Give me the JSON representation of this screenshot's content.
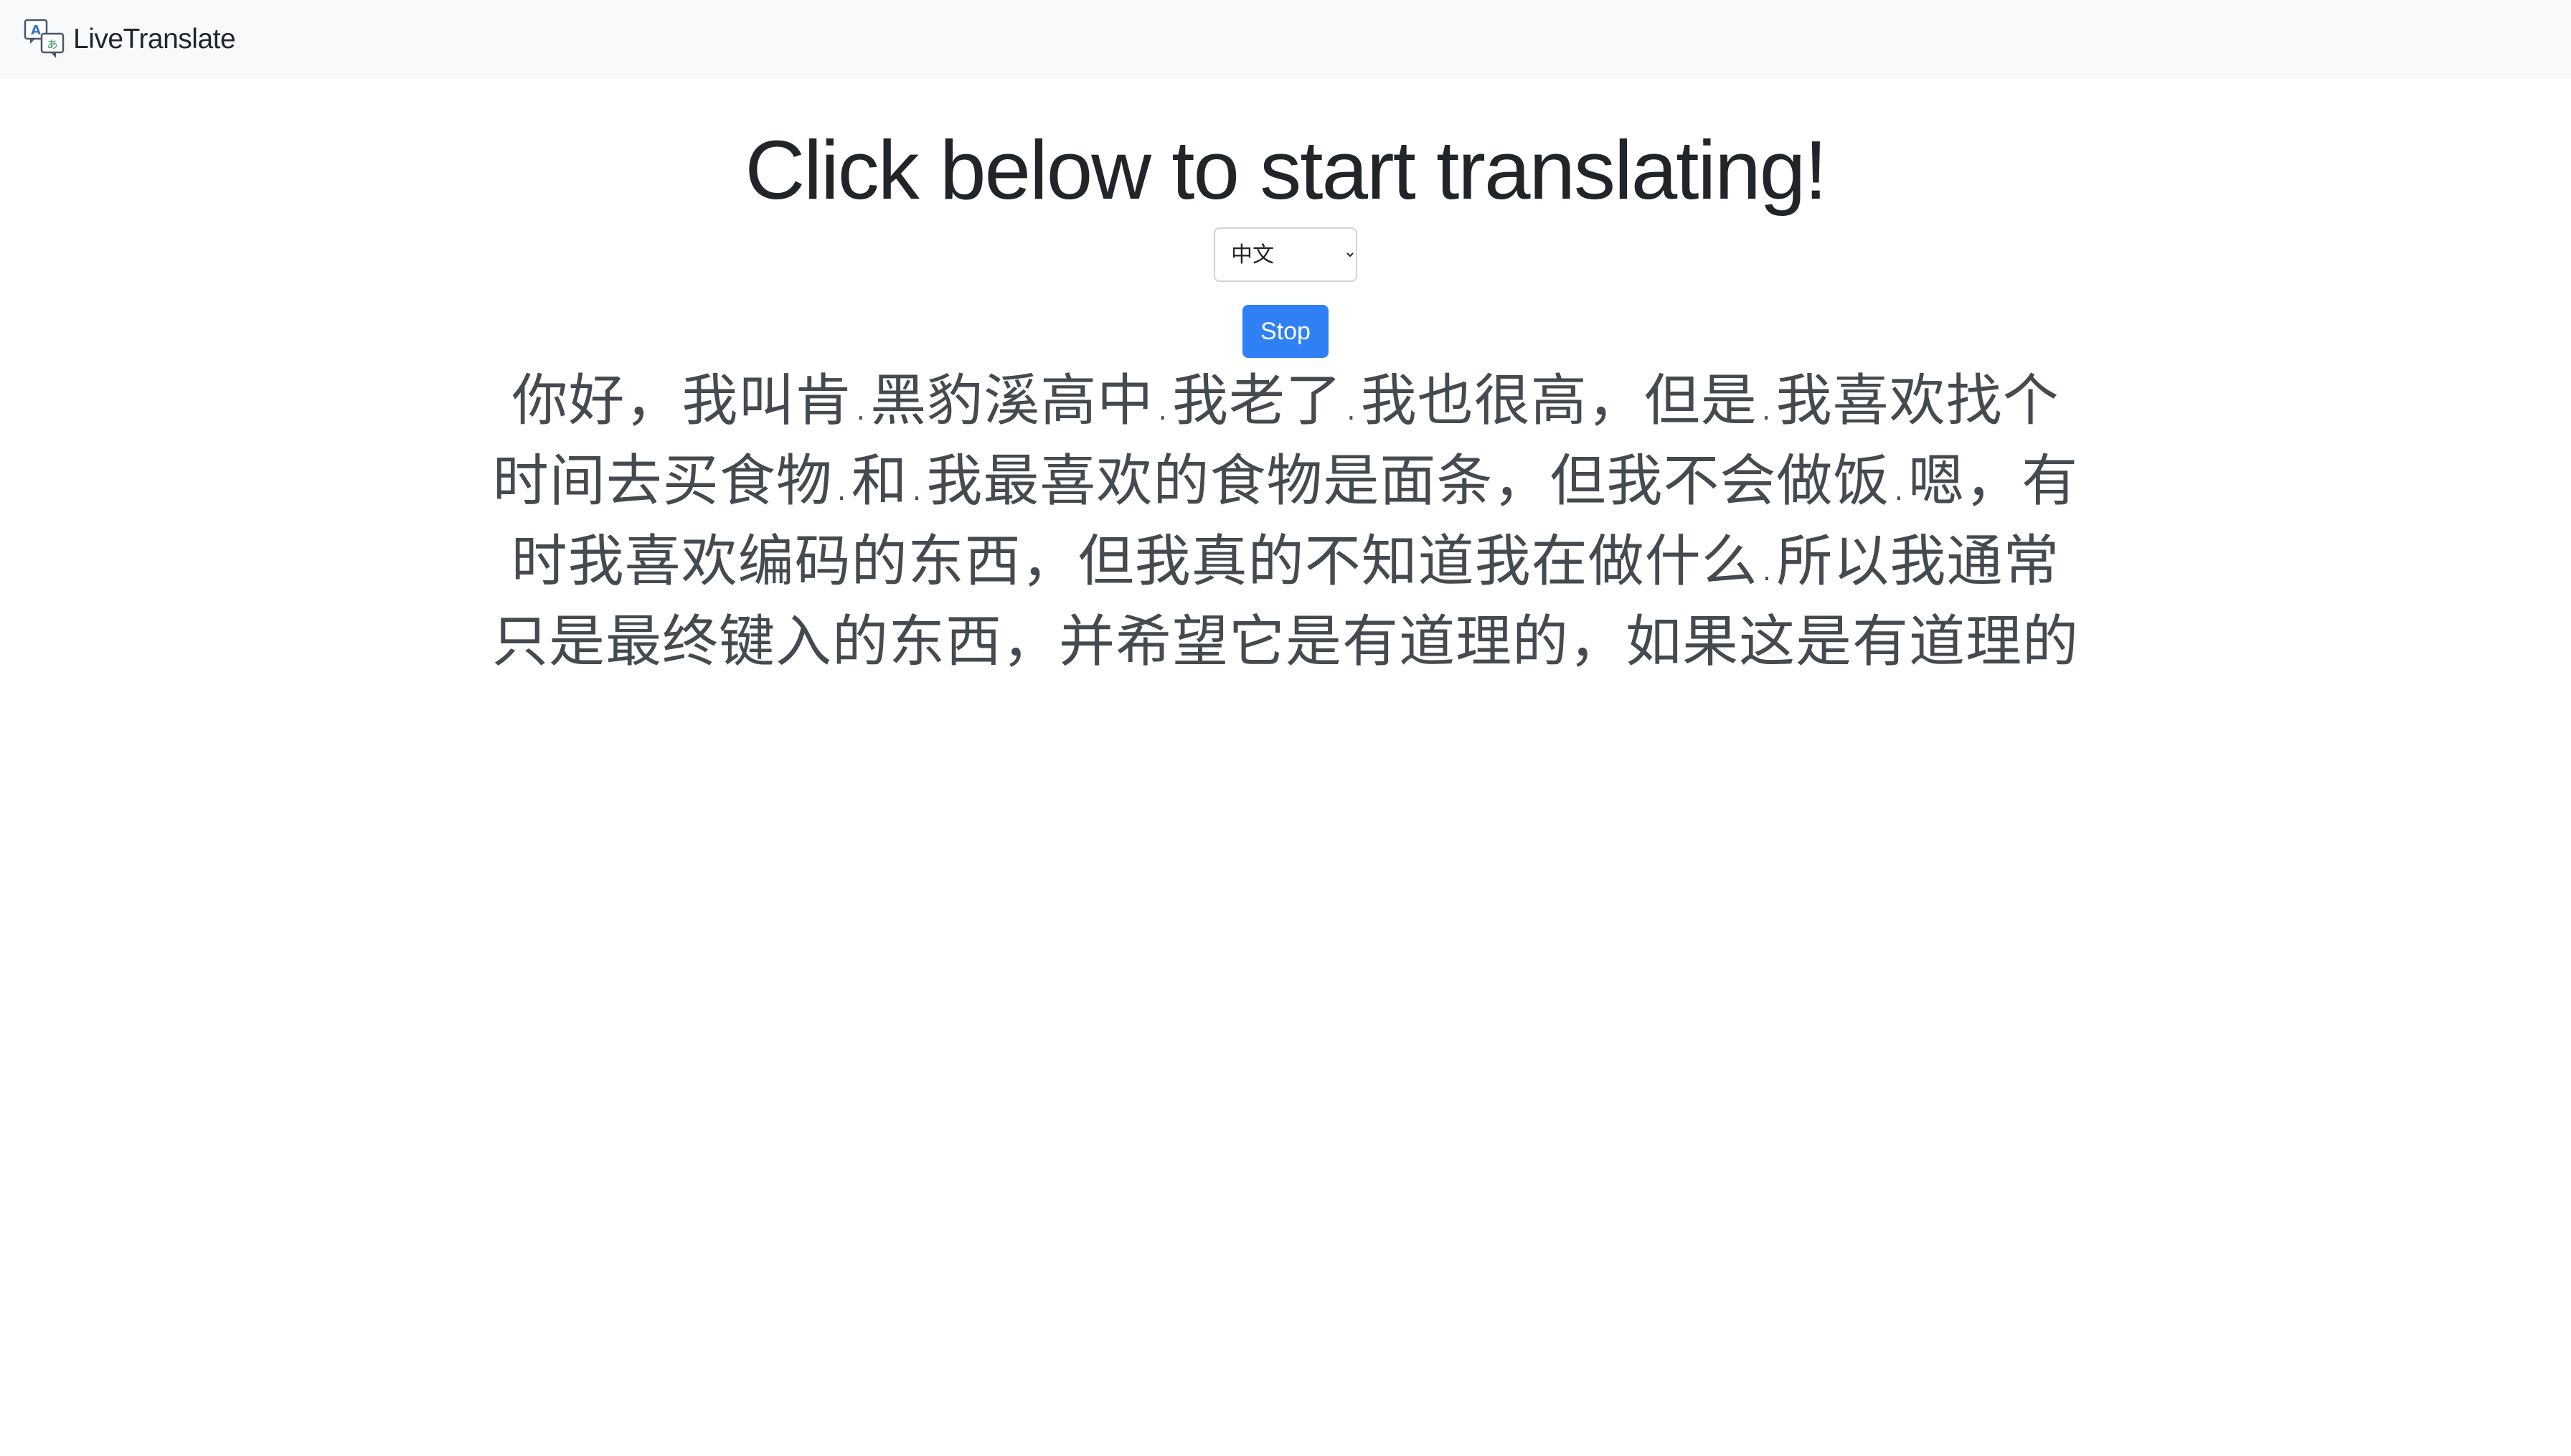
{
  "navbar": {
    "brand": "LiveTranslate",
    "logo_icon": "translate-icon"
  },
  "main": {
    "title": "Click below to start translating!",
    "language_select": {
      "selected": "中文",
      "options": [
        "中文"
      ]
    },
    "stop_button": "Stop",
    "translation_text": "你好，我叫肯.黑豹溪高中.我老了.我也很高，但是.我喜欢找个时间去买食物.和.我最喜欢的食物是面条，但我不会做饭.嗯，有时我喜欢编码的东西，但我真的不知道我在做什么.所以我通常只是最终键入的东西，并希望它是有道理的，如果这是有道理的"
  },
  "colors": {
    "navbar_bg": "#f8f9fa",
    "button_bg": "#2f80f5",
    "text": "#212529"
  }
}
